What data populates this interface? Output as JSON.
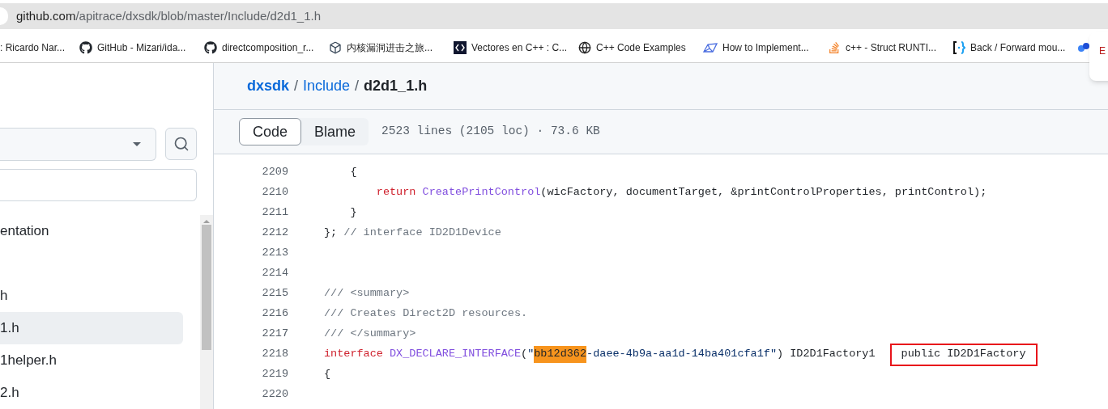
{
  "address_bar": {
    "host": "github.com",
    "path": "/apitrace/dxsdk/blob/master/Include/d2d1_1.h"
  },
  "bookmarks": [
    {
      "kind": "none",
      "label": ": Ricardo Nar..."
    },
    {
      "kind": "github",
      "label": "GitHub - Mizari/ida..."
    },
    {
      "kind": "github",
      "label": "directcomposition_r..."
    },
    {
      "kind": "cube",
      "label": "内核漏洞进击之旅..."
    },
    {
      "kind": "dark",
      "label": "Vectores en C++ : C..."
    },
    {
      "kind": "globe",
      "label": "C++ Code Examples"
    },
    {
      "kind": "shape",
      "label": "How to Implement..."
    },
    {
      "kind": "stack",
      "label": "c++ - Struct RUNTI..."
    },
    {
      "kind": "brackets",
      "label": "Back / Forward mou..."
    },
    {
      "kind": "blue"
    }
  ],
  "popup": {
    "text": "E"
  },
  "sidebar": {
    "items": [
      {
        "label": "entation",
        "selected": false
      },
      {
        "label": "h",
        "selected": false
      },
      {
        "label": "1.h",
        "selected": true
      },
      {
        "label": "1helper.h",
        "selected": false
      },
      {
        "label": "2.h",
        "selected": false
      }
    ]
  },
  "breadcrumb": [
    {
      "kind": "repo",
      "text": "dxsdk"
    },
    {
      "kind": "separator",
      "text": "/"
    },
    {
      "kind": "folder",
      "text": "Include"
    },
    {
      "kind": "separator",
      "text": "/"
    },
    {
      "kind": "file",
      "text": "d2d1_1.h"
    }
  ],
  "tabs": [
    {
      "label": "Code",
      "selected": true
    },
    {
      "label": "Blame",
      "selected": false
    }
  ],
  "file_info": "2523 lines (2105 loc) · 73.6 KB",
  "code_lines": [
    {
      "number": "2209",
      "tokens": [
        {
          "kind": "plain",
          "text": "    {"
        }
      ]
    },
    {
      "number": "2210",
      "tokens": [
        {
          "kind": "keyword",
          "text": "        return "
        },
        {
          "kind": "function",
          "text": "CreatePrintControl"
        },
        {
          "kind": "plain",
          "text": "(wicFactory, documentTarget, &printControlProperties, printControl);"
        }
      ]
    },
    {
      "number": "2211",
      "tokens": [
        {
          "kind": "plain",
          "text": "    }"
        }
      ]
    },
    {
      "number": "2212",
      "tokens": [
        {
          "kind": "plain",
          "text": "}; "
        },
        {
          "kind": "comment",
          "text": "// interface ID2D1Device"
        }
      ]
    },
    {
      "number": "2213"
    },
    {
      "number": "2214"
    },
    {
      "number": "2215",
      "tokens": [
        {
          "kind": "comment",
          "text": "/// <summary>"
        }
      ]
    },
    {
      "number": "2216",
      "tokens": [
        {
          "kind": "comment",
          "text": "/// Creates Direct2D resources."
        }
      ]
    },
    {
      "number": "2217",
      "tokens": [
        {
          "kind": "comment",
          "text": "/// </summary>"
        }
      ]
    },
    {
      "number": "2218",
      "tokens": [
        {
          "kind": "keyword",
          "text": "interface "
        },
        {
          "kind": "function",
          "text": "DX_DECLARE_INTERFACE"
        },
        {
          "kind": "plain",
          "text": "("
        },
        {
          "kind": "string",
          "text": "\""
        },
        {
          "kind": "highlight",
          "text": "bb12d362"
        },
        {
          "kind": "string",
          "text": "-daee-4b9a-aa1d-14ba401cfa1f\""
        },
        {
          "kind": "plain",
          "text": ") ID2D1Factory1"
        },
        {
          "kind": "boxed",
          "text": "public ID2D1Factory"
        }
      ]
    },
    {
      "number": "2219",
      "tokens": [
        {
          "kind": "plain",
          "text": "{"
        }
      ]
    },
    {
      "number": "2220"
    }
  ]
}
